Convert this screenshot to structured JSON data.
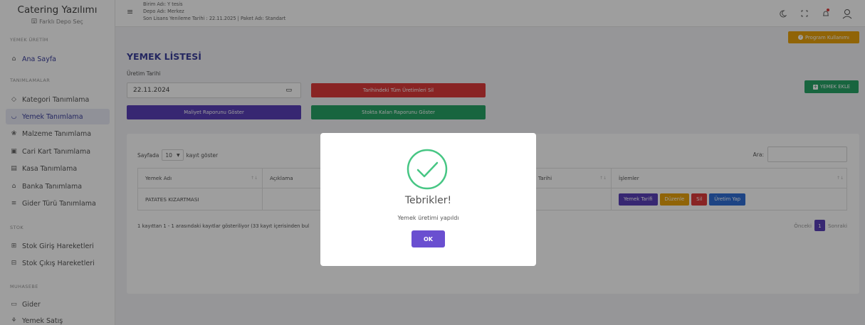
{
  "app": {
    "title": "Catering Yazılımı",
    "depo_link": "Farklı Depo Seç"
  },
  "sidebar": {
    "sections": [
      "YEMEK ÜRETİM",
      "TANIMLAMALAR",
      "STOK",
      "MUHASEBE"
    ],
    "items": [
      {
        "label": "Ana Sayfa",
        "icon": "home-icon"
      },
      {
        "label": "Kategori Tanımlama",
        "icon": "tag-icon"
      },
      {
        "label": "Yemek Tanımlama",
        "icon": "bowl-icon"
      },
      {
        "label": "Malzeme Tanımlama",
        "icon": "ingredient-icon"
      },
      {
        "label": "Cari Kart Tanımlama",
        "icon": "card-icon"
      },
      {
        "label": "Kasa Tanımlama",
        "icon": "cashbox-icon"
      },
      {
        "label": "Banka Tanımlama",
        "icon": "bank-icon"
      },
      {
        "label": "Gider Türü Tanımlama",
        "icon": "list-icon"
      },
      {
        "label": "Stok Giriş Hareketleri",
        "icon": "stock-in-icon"
      },
      {
        "label": "Stok Çıkış Hareketleri",
        "icon": "stock-out-icon"
      },
      {
        "label": "Gider",
        "icon": "expense-icon"
      },
      {
        "label": "Yemek Satış",
        "icon": "sale-icon"
      }
    ]
  },
  "topbar": {
    "birim": "Birim Adı: Y tesis",
    "depo": "Depo Adı: Merkez",
    "lisans": "Son Lisans Yenileme Tarihi : 22.11.2025 | Paket Adı: Standart"
  },
  "main": {
    "program_button": "Program Kullanımı",
    "page_title": "YEMEK LİSTESİ",
    "date_label": "Üretim Tarihi",
    "date_value": "22.11.2024",
    "delete_all_button": "Tarihindeki Tüm Üretimleri Sil",
    "cost_report_button": "Maliyet Raporunu Göster",
    "stock_report_button": "Stokta Kalan Raporunu Göster",
    "add_button": "YEMEK EKLE"
  },
  "table": {
    "length_prefix": "Sayfada",
    "length_value": "10",
    "length_suffix": "kayıt göster",
    "search_label": "Ara:",
    "headers": [
      "Yemek Adı",
      "Açıklama",
      "Tarihi",
      "İşlemler"
    ],
    "rows": [
      {
        "name": "PATATES KIZARTMASI"
      }
    ],
    "actions": [
      {
        "label": "Yemek Tarifi",
        "color": "#5a3fb8"
      },
      {
        "label": "Düzenle",
        "color": "#e8a20c"
      },
      {
        "label": "Sil",
        "color": "#dd3b3b"
      },
      {
        "label": "Üretim Yap",
        "color": "#2f6fd6"
      }
    ],
    "info": "1 kayıttan 1 - 1 arasındaki kayıtlar gösteriliyor (33 kayıt içerisinden bul",
    "prev": "Önceki",
    "page": "1",
    "next": "Sonraki"
  },
  "modal": {
    "title": "Tebrikler!",
    "text": "Yemek üretimi yapıldı",
    "ok": "OK",
    "accent": "#47c684"
  }
}
